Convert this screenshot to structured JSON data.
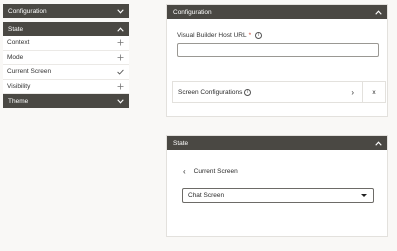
{
  "left_nav": {
    "configuration_label": "Configuration",
    "state_label": "State",
    "items": [
      {
        "label": "Context",
        "icon": "plus-icon"
      },
      {
        "label": "Mode",
        "icon": "plus-icon"
      },
      {
        "label": "Current Screen",
        "icon": "check-icon"
      },
      {
        "label": "Visibility",
        "icon": "plus-icon"
      }
    ],
    "theme_label": "Theme"
  },
  "configuration_panel": {
    "title": "Configuration",
    "host_url_label": "Visual Builder Host URL",
    "required_marker": "*",
    "host_url_value": "",
    "screen_configurations_label": "Screen Configurations",
    "nav_glyph": "›",
    "close_glyph": "x"
  },
  "state_panel": {
    "title": "State",
    "back_glyph": "‹",
    "current_screen_label": "Current Screen",
    "selected_screen": "Chat Screen"
  },
  "colors": {
    "header_bg": "#4a4843",
    "required": "#c74634",
    "page_bg": "#f9f8f6"
  }
}
